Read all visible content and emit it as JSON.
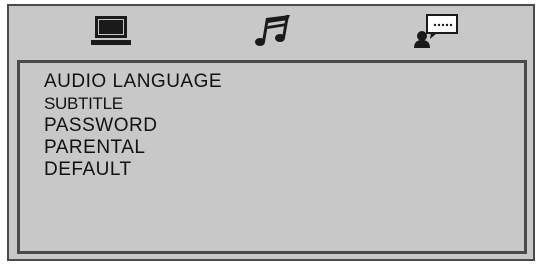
{
  "tabs": [
    {
      "icon": "monitor-icon",
      "label": "System"
    },
    {
      "icon": "music-note-icon",
      "label": "Audio"
    },
    {
      "icon": "user-chat-icon",
      "label": "Preference"
    }
  ],
  "menu": {
    "items": [
      {
        "label": "AUDIO LANGUAGE"
      },
      {
        "label": "SUBTITLE"
      },
      {
        "label": "PASSWORD"
      },
      {
        "label": "PARENTAL"
      },
      {
        "label": "DEFAULT"
      }
    ]
  },
  "colors": {
    "background": "#c8c8c8",
    "border": "#4a4a4a",
    "icon": "#1a1a1a",
    "text": "#111111"
  }
}
